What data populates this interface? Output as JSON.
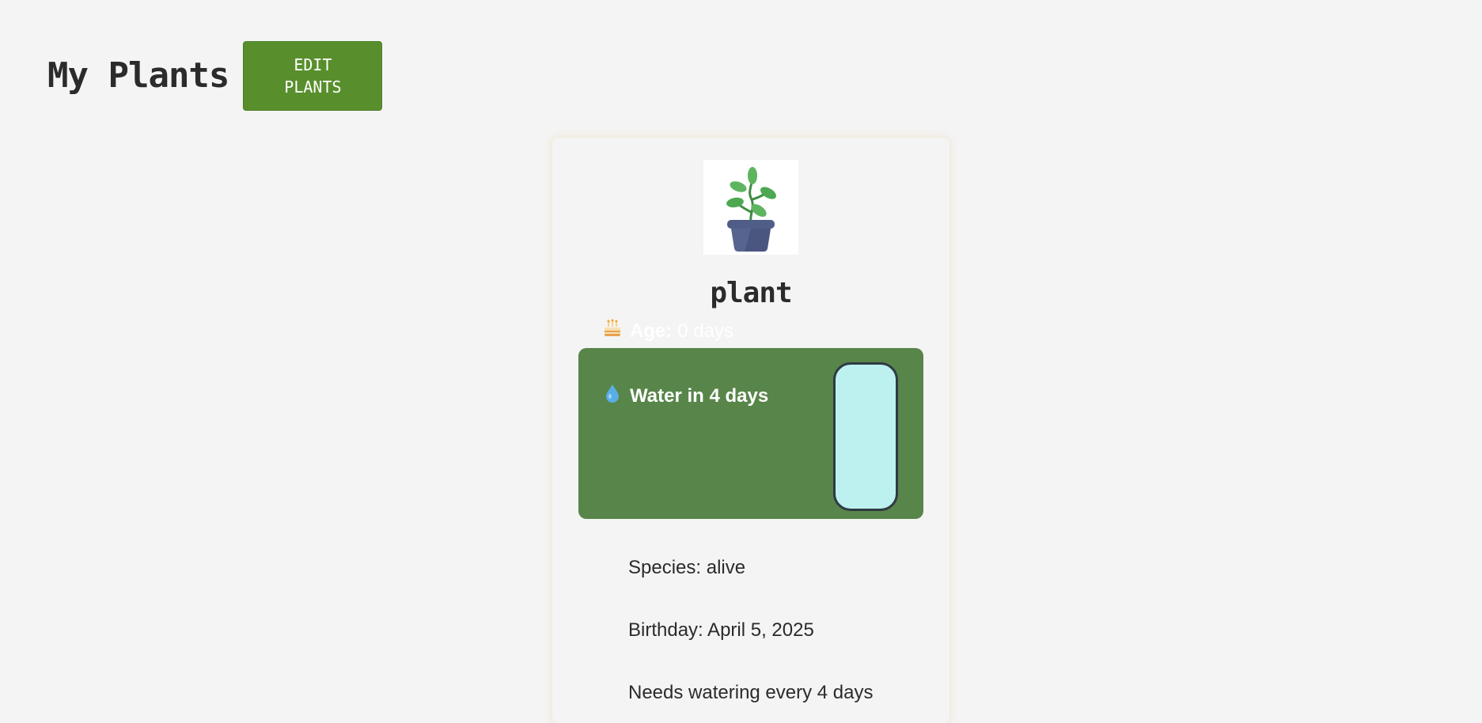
{
  "header": {
    "title": "My Plants",
    "edit_button": "EDIT\nPLANTS"
  },
  "plant": {
    "name": "plant",
    "image_icon": "potted-plant-icon",
    "status": {
      "age_icon": "birthday-cake-icon",
      "age_label": "Age:",
      "age_value": "0 days",
      "water_icon": "water-drop-icon",
      "water_text": "Water in 4 days",
      "water_level": 1.0
    },
    "details": {
      "species": "Species: alive",
      "birthday": "Birthday: April 5, 2025",
      "watering": "Needs watering every 4 days"
    }
  },
  "colors": {
    "background": "#f4f4f4",
    "button_green": "#588f2c",
    "panel_green": "#588549",
    "water_fill": "#bdf1ef"
  }
}
